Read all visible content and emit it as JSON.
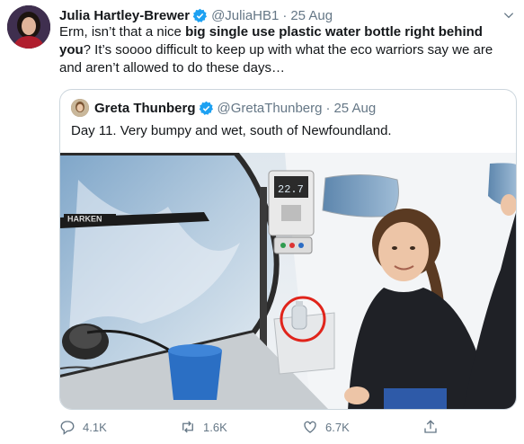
{
  "author": {
    "name": "Julia Hartley-Brewer",
    "handle": "@JuliaHB1",
    "separator": "·",
    "date": "25 Aug"
  },
  "tweet": {
    "text_part1": "Erm, isn’t that a nice ",
    "text_bold": "big single use plastic water bottle right behind you",
    "text_part2": "? It’s soooo difficult to keep up with what the eco warriors say we are and aren’t allowed to do these days…"
  },
  "quoted": {
    "name": "Greta Thunberg",
    "handle": "@GretaThunberg",
    "separator": "·",
    "date": "25 Aug",
    "text": "Day 11. Very bumpy and wet, south of Newfoundland.",
    "photo_brand_text": "HARKEN",
    "instrument_readout": "22.7"
  },
  "actions": {
    "reply_count": "4.1K",
    "retweet_count": "1.6K",
    "like_count": "6.7K"
  },
  "colors": {
    "verified": "#1da1f2",
    "meta": "#657786",
    "border": "#ccd6dd",
    "highlight_circle": "#e0241b"
  },
  "icons": [
    "verified-icon",
    "chevron-down-icon",
    "reply-icon",
    "retweet-icon",
    "like-icon",
    "share-icon"
  ]
}
